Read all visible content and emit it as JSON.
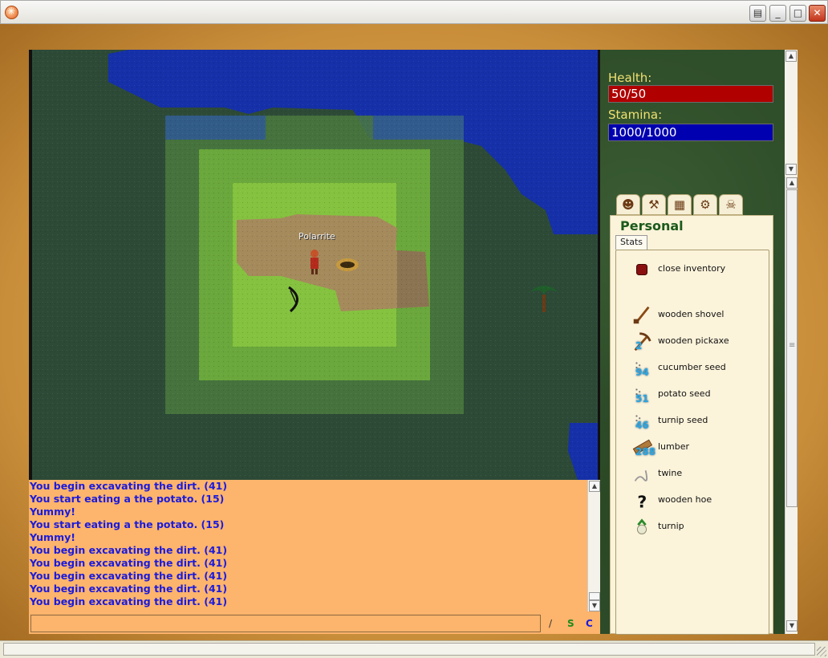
{
  "window": {
    "controls": [
      "restore-icon",
      "minimize-icon",
      "maximize-icon",
      "close-icon"
    ]
  },
  "map": {
    "player_name": "Polarrite"
  },
  "stats": {
    "health_label": "Health:",
    "health_value": "50/50",
    "health_color": "#b00000",
    "stamina_label": "Stamina:",
    "stamina_value": "1000/1000",
    "stamina_color": "#0000b0"
  },
  "chat": {
    "lines": [
      "You begin excavating the dirt. (41)",
      "You start eating a the potato. (15)",
      "Yummy!",
      "You start eating a the potato. (15)",
      "Yummy!",
      "You begin excavating the dirt. (41)",
      "You begin excavating the dirt. (41)",
      "You begin excavating the dirt. (41)",
      "You begin excavating the dirt. (41)",
      "You begin excavating the dirt. (41)"
    ],
    "input_value": "",
    "commands": {
      "slash": "/",
      "say": "S",
      "clan": "C"
    },
    "text_color": "#1b1bdc",
    "background_color": "#fdb46c"
  },
  "panel": {
    "tabs": [
      "personal-icon",
      "tools-icon",
      "map-icon",
      "crafting-icon",
      "building-icon"
    ],
    "title": "Personal",
    "subtab": "Stats",
    "items": [
      {
        "label": "close inventory",
        "icon": "close-inventory-icon",
        "qty": ""
      },
      {
        "label": "wooden shovel",
        "icon": "shovel-icon",
        "qty": ""
      },
      {
        "label": "wooden pickaxe",
        "icon": "pickaxe-icon",
        "qty": "2"
      },
      {
        "label": "cucumber seed",
        "icon": "seed-icon",
        "qty": "94"
      },
      {
        "label": "potato seed",
        "icon": "seed-icon",
        "qty": "51"
      },
      {
        "label": "turnip seed",
        "icon": "seed-icon",
        "qty": "46"
      },
      {
        "label": "lumber",
        "icon": "lumber-icon",
        "qty": "288"
      },
      {
        "label": "twine",
        "icon": "twine-icon",
        "qty": ""
      },
      {
        "label": "wooden hoe",
        "icon": "unknown-item-icon",
        "qty": ""
      },
      {
        "label": "turnip",
        "icon": "turnip-icon",
        "qty": ""
      }
    ]
  }
}
